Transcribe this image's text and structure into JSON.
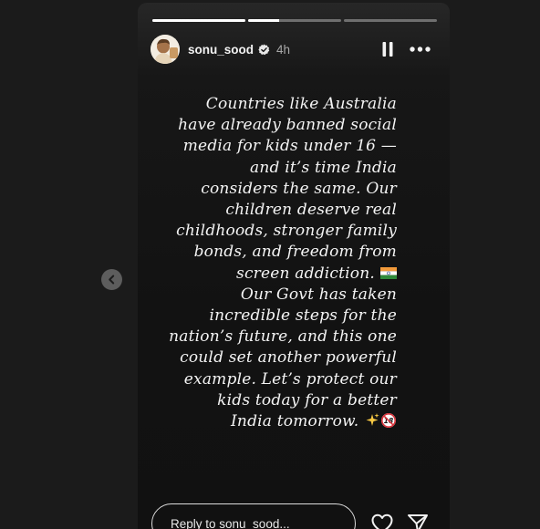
{
  "story": {
    "username": "sonu_sood",
    "time": "4h",
    "progress": [
      {
        "fill": 1.0
      },
      {
        "fill": 0.33
      },
      {
        "fill": 0.0
      }
    ],
    "text_lines": [
      "Countries like Australia",
      "have already banned social",
      "media for kids under 16 —",
      "and it’s time India",
      "considers the same. Our",
      "children deserve real",
      "childhoods, stronger family",
      "bonds, and freedom from",
      "screen addiction.",
      "Our Govt has taken",
      "incredible steps for the",
      "nation’s future, and this one",
      "could set another powerful",
      "example. Let’s protect our",
      "kids today for a better",
      "India tomorrow."
    ],
    "emojis": [
      "india-flag",
      "sparkles",
      "no-under-18"
    ]
  },
  "reply": {
    "placeholder": "Reply to sonu_sood..."
  },
  "icons": {
    "verified": "verified-badge-icon",
    "pause": "pause-icon",
    "more": "more-options-icon",
    "prev": "chevron-left-icon",
    "like": "heart-icon",
    "share": "send-icon"
  }
}
